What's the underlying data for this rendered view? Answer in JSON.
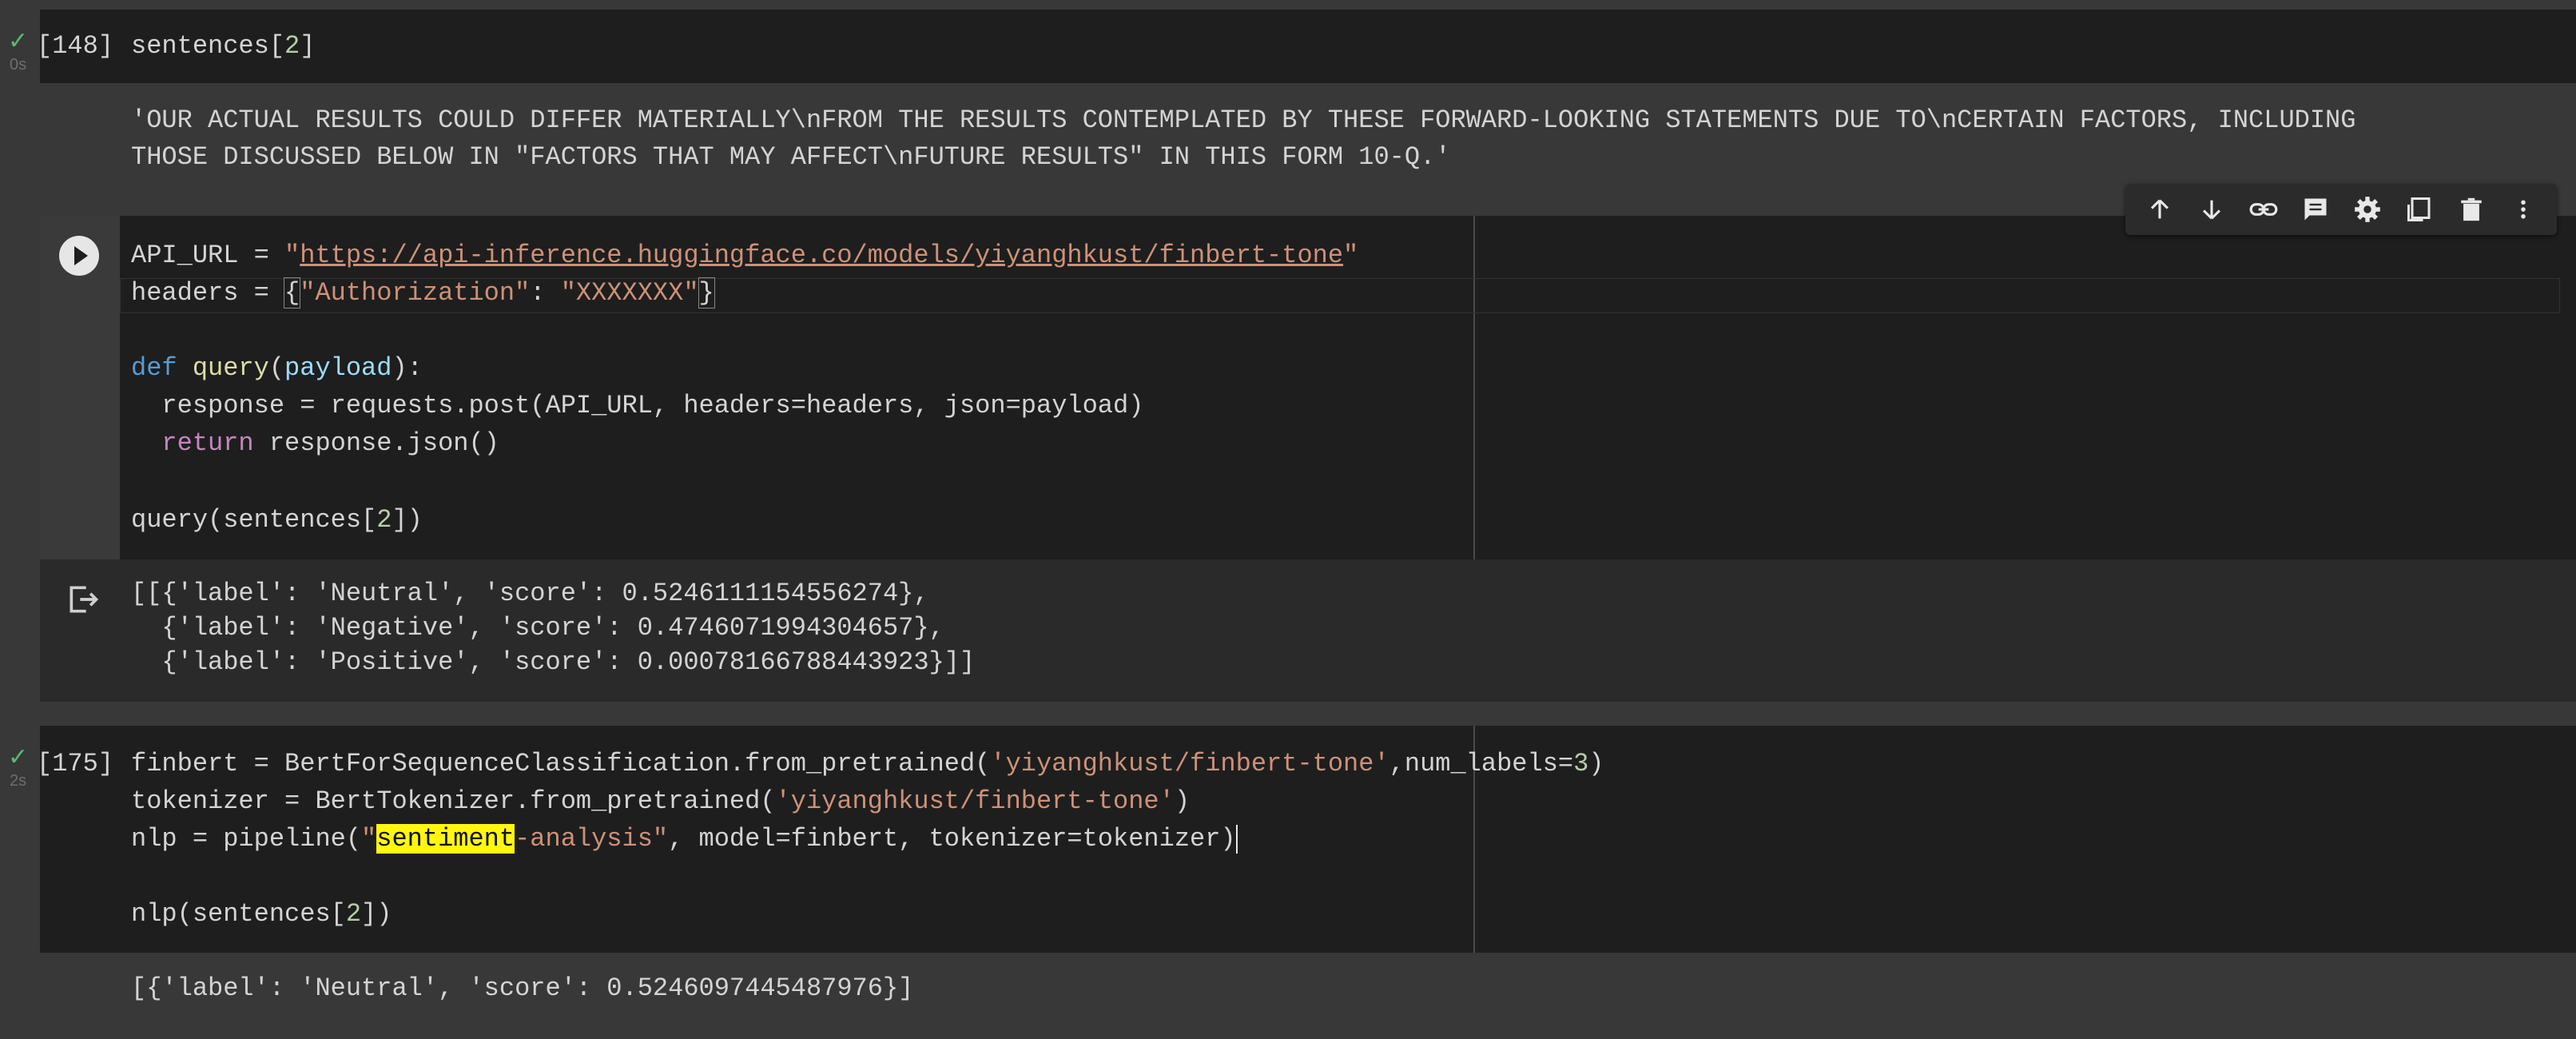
{
  "cells": {
    "cell1": {
      "exec_count": "[148]",
      "exec_time": "0s",
      "code": {
        "pre": "sentences[",
        "num": "2",
        "post": "]"
      },
      "output": [
        "'OUR ACTUAL RESULTS COULD DIFFER MATERIALLY\\nFROM THE RESULTS CONTEMPLATED BY THESE FORWARD-LOOKING STATEMENTS DUE TO\\nCERTAIN FACTORS, INCLUDING",
        "THOSE DISCUSSED BELOW IN \"FACTORS THAT MAY AFFECT\\nFUTURE RESULTS\" IN THIS FORM 10-Q.'"
      ]
    },
    "cell2": {
      "line1": {
        "a": "API_URL = ",
        "q1": "\"",
        "url": "https://api-inference.huggingface.co/models/yiyanghkust/finbert-tone",
        "q2": "\""
      },
      "line2": {
        "a": "headers = ",
        "b": "{",
        "key": "\"Authorization\"",
        "c": ": ",
        "val": "\"XXXXXXX\"",
        "d": "}"
      },
      "line4": {
        "kw": "def",
        "sp": " ",
        "fn": "query",
        "p1": "(",
        "param": "payload",
        "p2": "):"
      },
      "line5": "  response = requests.post(API_URL, headers=headers, json=payload)",
      "line6": {
        "indent": "  ",
        "kw": "return",
        "rest": " response.json()"
      },
      "line8": {
        "pre": "query(sentences[",
        "num": "2",
        "post": "])"
      },
      "output": [
        "[[{'label': 'Neutral', 'score': 0.5246111154556274},",
        "  {'label': 'Negative', 'score': 0.4746071994304657},",
        "  {'label': 'Positive', 'score': 0.00078166788443923}]]"
      ]
    },
    "cell3": {
      "exec_count": "[175]",
      "exec_time": "2s",
      "line1": {
        "a": "finbert = BertForSequenceClassification.from_pretrained(",
        "s": "'yiyanghkust/finbert-tone'",
        "b": ",num_labels=",
        "n": "3",
        "c": ")"
      },
      "line2": {
        "a": "tokenizer = BertTokenizer.from_pretrained(",
        "s": "'yiyanghkust/finbert-tone'",
        "c": ")"
      },
      "line3": {
        "a": "nlp = pipeline(",
        "q": "\"",
        "hl": "sentiment",
        "s": "-analysis\"",
        "b": ", model=finbert, tokenizer=tokenizer)"
      },
      "line5": {
        "pre": "nlp(sentences[",
        "num": "2",
        "post": "])"
      },
      "output": "[{'label': 'Neutral', 'score': 0.5246097445487976}]"
    }
  },
  "toolbar": {
    "icons": [
      "arrow-up-icon",
      "arrow-down-icon",
      "link-icon",
      "comment-icon",
      "settings-icon",
      "mirror-cell-icon",
      "delete-icon",
      "more-icon"
    ]
  },
  "colors": {
    "accent_green": "#5bb974",
    "string": "#ce9178",
    "keyword": "#569cd6",
    "number": "#b5cea8",
    "highlight": "#fff70f"
  }
}
